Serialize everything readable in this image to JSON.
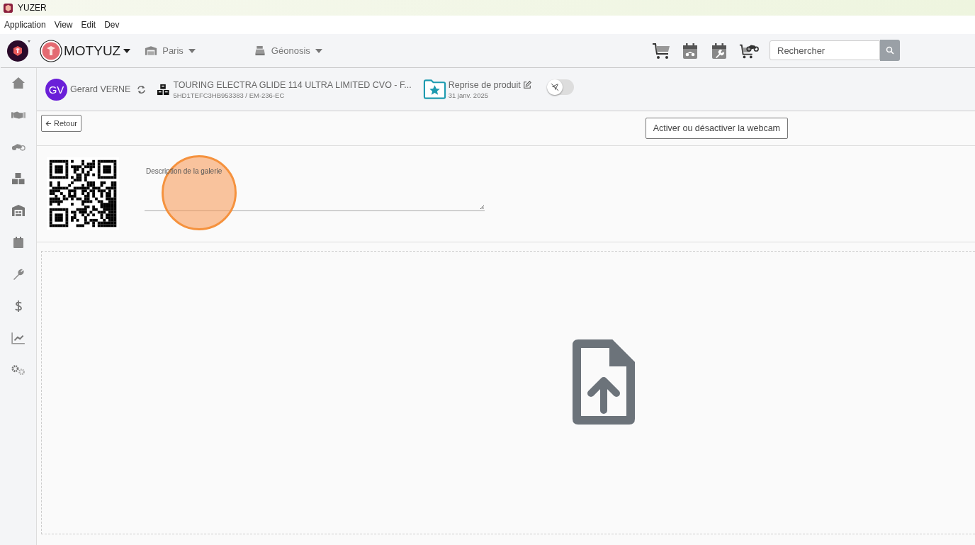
{
  "window": {
    "title": "YUZER"
  },
  "menu": [
    {
      "label": "Application"
    },
    {
      "label": "View"
    },
    {
      "label": "Edit"
    },
    {
      "label": "Dev"
    }
  ],
  "top_bar": {
    "company": "MOTYUZ",
    "site": "Paris",
    "workstation": "Géonosis",
    "search": {
      "placeholder": "Rechercher"
    }
  },
  "sidebar": {
    "items": [
      {
        "kind": "home"
      },
      {
        "kind": "handshake"
      },
      {
        "kind": "motorcycle"
      },
      {
        "kind": "boxes"
      },
      {
        "kind": "warehouse"
      },
      {
        "kind": "calendar"
      },
      {
        "kind": "wrench"
      },
      {
        "kind": "dollar"
      },
      {
        "kind": "chart"
      },
      {
        "kind": "gears"
      }
    ]
  },
  "header": {
    "customer": {
      "initials": "GV",
      "name": "Gerard VERNE"
    },
    "vehicle": {
      "title": "TOURING ELECTRA GLIDE 114 ULTRA LIMITED CVO - F...",
      "subtitle": "5HD1TEFC3HB953383 / EM-236-EC"
    },
    "folder": {
      "title": "Reprise de produit",
      "date": "31 janv. 2025"
    },
    "toggle": {
      "on": false
    }
  },
  "actions": {
    "back": "Retour",
    "webcam": "Activer ou désactiver la webcam"
  },
  "gallery": {
    "description": {
      "label": "Description de la galerie"
    }
  }
}
